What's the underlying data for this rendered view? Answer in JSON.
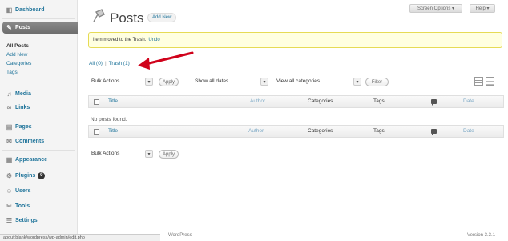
{
  "sidebar": {
    "items": [
      {
        "key": "dashboard",
        "label": "Dashboard",
        "icon": "dashboard-icon"
      },
      {
        "key": "posts",
        "label": "Posts",
        "icon": "pin-icon"
      },
      {
        "key": "media",
        "label": "Media",
        "icon": "media-icon"
      },
      {
        "key": "links",
        "label": "Links",
        "icon": "links-icon"
      },
      {
        "key": "pages",
        "label": "Pages",
        "icon": "pages-icon"
      },
      {
        "key": "comments",
        "label": "Comments",
        "icon": "comments-icon"
      },
      {
        "key": "appearance",
        "label": "Appearance",
        "icon": "appearance-icon"
      },
      {
        "key": "plugins",
        "label": "Plugins",
        "icon": "plugins-icon",
        "badge": "0"
      },
      {
        "key": "users",
        "label": "Users",
        "icon": "users-icon"
      },
      {
        "key": "tools",
        "label": "Tools",
        "icon": "tools-icon"
      },
      {
        "key": "settings",
        "label": "Settings",
        "icon": "settings-icon"
      }
    ],
    "posts_submenu": [
      "All Posts",
      "Add New",
      "Categories",
      "Tags"
    ]
  },
  "header": {
    "title": "Posts",
    "add_new": "Add New",
    "screen_options": "Screen Options ▾",
    "help": "Help ▾"
  },
  "notice": {
    "text": "Item moved to the Trash.",
    "undo": "Undo"
  },
  "subsubsub": {
    "all": "All (0)",
    "sep": "|",
    "trash": "Trash (1)"
  },
  "controls": {
    "bulk_actions": "Bulk Actions",
    "apply": "Apply",
    "show_all_dates": "Show all dates",
    "view_all_categories": "View all categories",
    "filter": "Filter"
  },
  "table": {
    "columns": {
      "title": "Title",
      "author": "Author",
      "categories": "Categories",
      "tags": "Tags",
      "date": "Date"
    },
    "empty_message": "No posts found."
  },
  "footer": {
    "status_url": "about:blank/wordpress/wp-admin/edit.php",
    "thanks": "WordPress",
    "version": "Version 3.3.1"
  },
  "colors": {
    "link": "#21759b",
    "notice_bg": "#ffffe0",
    "notice_border": "#e6db55",
    "arrow": "#d0021b"
  }
}
